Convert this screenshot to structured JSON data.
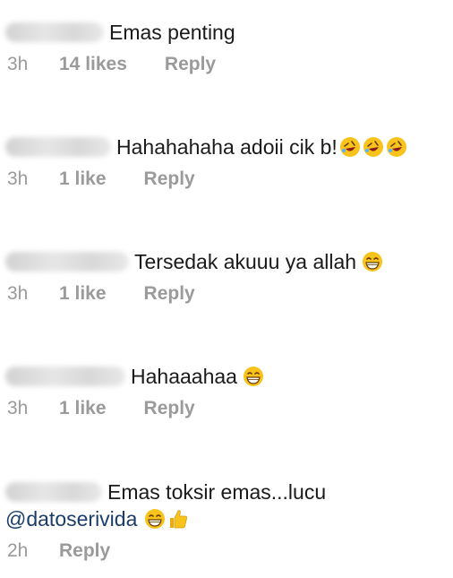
{
  "comments": [
    {
      "text": "Emas penting",
      "time": "3h",
      "likes": "14 likes",
      "reply": "Reply",
      "emojis": []
    },
    {
      "text": "Hahahahaha adoii cik b!",
      "time": "3h",
      "likes": "1 like",
      "reply": "Reply",
      "emojis": [
        "rolling-laughing-icon",
        "rolling-laughing-icon",
        "rolling-laughing-icon"
      ]
    },
    {
      "text": "Tersedak akuuu ya allah",
      "time": "3h",
      "likes": "1 like",
      "reply": "Reply",
      "emojis": [
        "grinning-face-icon"
      ]
    },
    {
      "text": "Hahaaahaa",
      "time": "3h",
      "likes": "1 like",
      "reply": "Reply",
      "emojis": [
        "grinning-face-icon"
      ]
    },
    {
      "text": "Emas toksir emas...lucu",
      "mention": "@datoserivida",
      "time": "2h",
      "reply": "Reply",
      "emojis": [
        "grinning-face-icon",
        "thumbs-up-icon"
      ]
    }
  ],
  "colors": {
    "text": "#1a1a1a",
    "meta": "#9a9a9a",
    "mention": "#1a3d6b",
    "emoji": "#f7c31c"
  }
}
